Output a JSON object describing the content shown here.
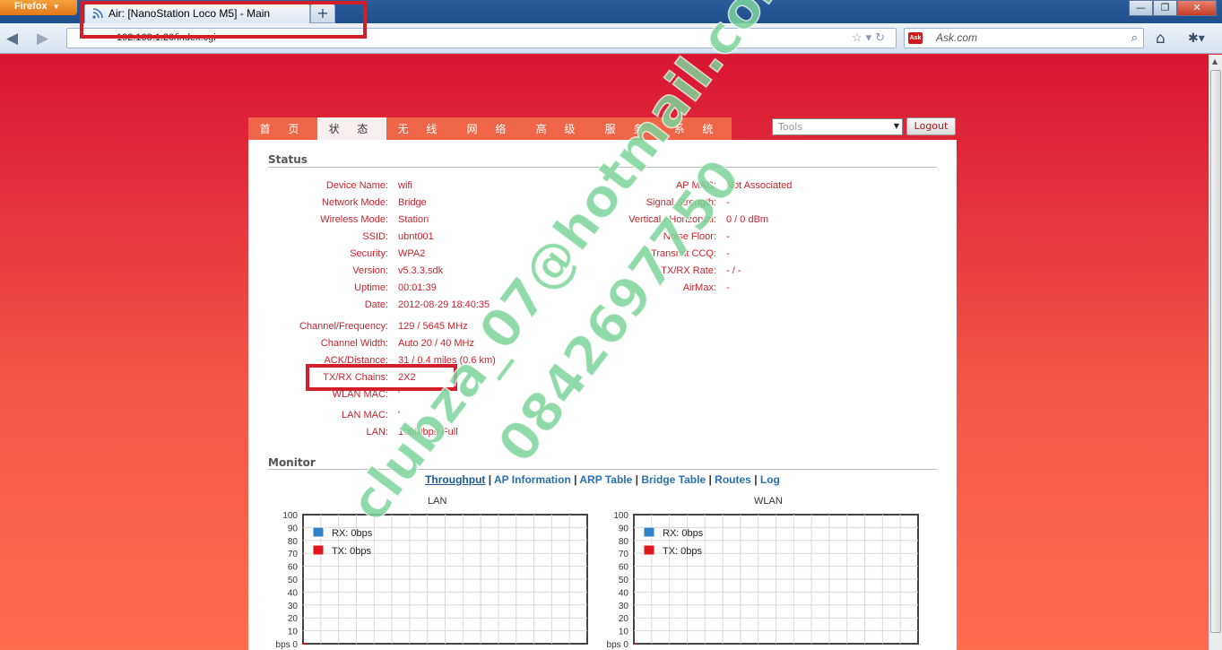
{
  "browser": {
    "menu_label": "Firefox",
    "tab_title": "Air: [NanoStation Loco M5] - Main",
    "new_tab_label": "+",
    "url": "192.168.1.20/index.cgi",
    "search_placeholder": "Ask.com",
    "search_engine_badge": "Ask"
  },
  "nav_menu": [
    "首 页",
    "状 态",
    "无 线",
    "网 络",
    "高 级",
    "服 务",
    "系 统"
  ],
  "active_menu_index": 1,
  "tools": {
    "selected": "Tools"
  },
  "logout_label": "Logout",
  "status": {
    "title": "Status",
    "left_group1": [
      {
        "label": "Device Name:",
        "value": "wifi"
      },
      {
        "label": "Network Mode:",
        "value": "Bridge"
      },
      {
        "label": "Wireless Mode:",
        "value": "Station"
      },
      {
        "label": "SSID:",
        "value": "ubnt001"
      },
      {
        "label": "Security:",
        "value": "WPA2"
      },
      {
        "label": "Version:",
        "value": "v5.3.3.sdk"
      },
      {
        "label": "Uptime:",
        "value": "00:01:39"
      },
      {
        "label": "Date:",
        "value": "2012-08-29 18:40:35"
      }
    ],
    "left_group2": [
      {
        "label": "Channel/Frequency:",
        "value": "129 / 5645 MHz"
      },
      {
        "label": "Channel Width:",
        "value": "Auto 20 / 40 MHz"
      },
      {
        "label": "ACK/Distance:",
        "value": "31 / 0.4 miles (0.6 km)"
      },
      {
        "label": "TX/RX Chains:",
        "value": "2X2"
      },
      {
        "label": "WLAN MAC:",
        "value": "'"
      },
      {
        "label": "LAN MAC:",
        "value": "'"
      },
      {
        "label": "LAN:",
        "value": "100Mbps-Full"
      }
    ],
    "right": [
      {
        "label": "AP MAC:",
        "value": "Not Associated"
      },
      {
        "label": "Signal Strength:",
        "value": "-"
      },
      {
        "label": "Vertical / Horizontal:",
        "value": "0 / 0 dBm"
      },
      {
        "label": "Noise Floor:",
        "value": "-"
      },
      {
        "label": "Transmit CCQ:",
        "value": "-"
      },
      {
        "label": "TX/RX Rate:",
        "value": "- / -"
      },
      {
        "label": "AirMax:",
        "value": "-"
      }
    ]
  },
  "monitor": {
    "title": "Monitor",
    "links": [
      "Throughput",
      "AP Information",
      "ARP Table",
      "Bridge Table",
      "Routes",
      "Log"
    ],
    "separator": "|",
    "active_link_index": 0
  },
  "chart_data": [
    {
      "type": "line",
      "title": "LAN",
      "yticks": [
        "100",
        "90",
        "80",
        "70",
        "60",
        "50",
        "40",
        "30",
        "20",
        "10",
        "bps 0"
      ],
      "ylim": [
        0,
        100
      ],
      "grid": true,
      "legend_position": "top-left",
      "series": [
        {
          "name": "RX: 0bps",
          "color": "#2f82c3",
          "values": [
            0
          ]
        },
        {
          "name": "TX: 0bps",
          "color": "#e0161c",
          "values": [
            0
          ]
        }
      ]
    },
    {
      "type": "line",
      "title": "WLAN",
      "yticks": [
        "100",
        "90",
        "80",
        "70",
        "60",
        "50",
        "40",
        "30",
        "20",
        "10",
        "bps 0"
      ],
      "ylim": [
        0,
        100
      ],
      "grid": true,
      "legend_position": "top-left",
      "series": [
        {
          "name": "RX: 0bps",
          "color": "#2f82c3",
          "values": [
            0
          ]
        },
        {
          "name": "TX: 0bps",
          "color": "#e0161c",
          "values": [
            0
          ]
        }
      ]
    }
  ],
  "watermark": {
    "line1": "clubza_07@hotmail.com",
    "line2": "0842697750",
    "color": "#7dd49a"
  },
  "colors": {
    "highlight_box": "#d21f2a",
    "menu_bg": "#ef6547",
    "label_red": "#c8242e"
  }
}
